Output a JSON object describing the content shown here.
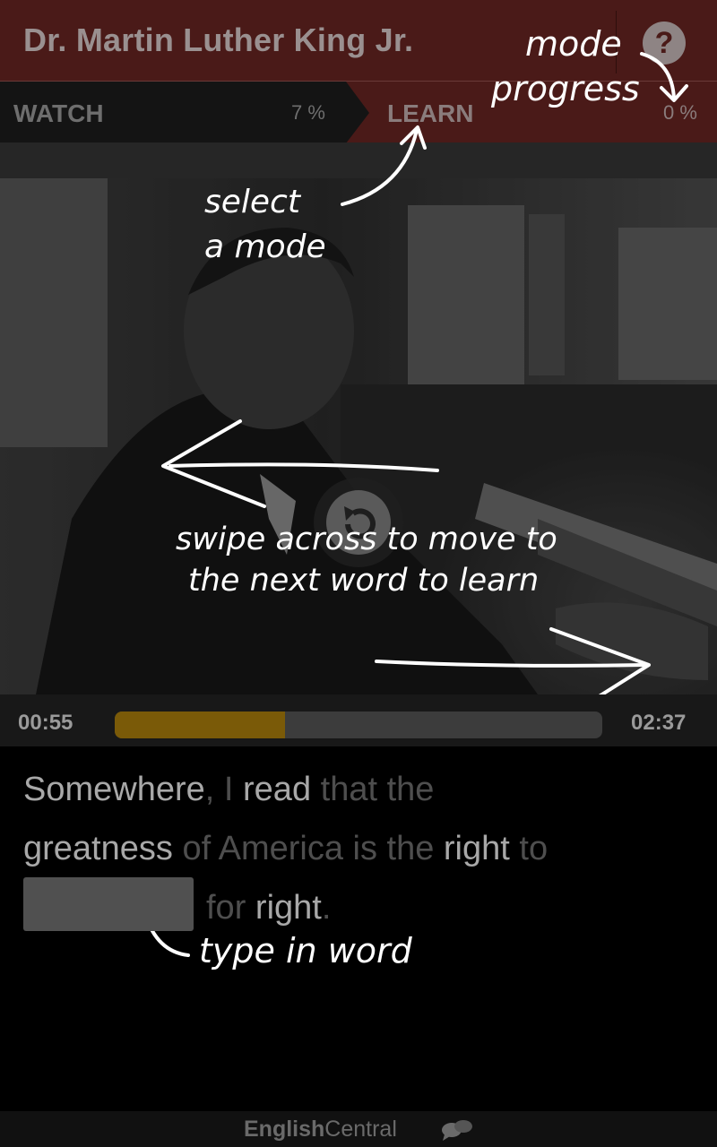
{
  "header": {
    "title": "Dr. Martin Luther King Jr.",
    "help_symbol": "?"
  },
  "tabs": [
    {
      "label": "WATCH",
      "progress": "7 %"
    },
    {
      "label": "LEARN",
      "progress": "0 %"
    }
  ],
  "annotations": {
    "mode_progress": [
      "mode",
      "progress"
    ],
    "select_mode": [
      "select",
      "a mode"
    ],
    "swipe": [
      "swipe across to move to",
      "the next word to learn"
    ],
    "type_word": "type in word"
  },
  "player": {
    "current_time": "00:55",
    "total_time": "02:37",
    "progress_fraction": 0.35
  },
  "sentence": {
    "line1": [
      "Somewhere",
      ",",
      " I ",
      "read",
      " that the"
    ],
    "line2": [
      "greatness",
      " of America is the ",
      "right",
      " to"
    ],
    "line3": [
      "for",
      " ",
      "right",
      "."
    ]
  },
  "footer": {
    "brand_bold": "English",
    "brand_regular": "Central"
  },
  "colors": {
    "header_bg": "#4a1a18",
    "progress_fill": "#7a5a08"
  }
}
